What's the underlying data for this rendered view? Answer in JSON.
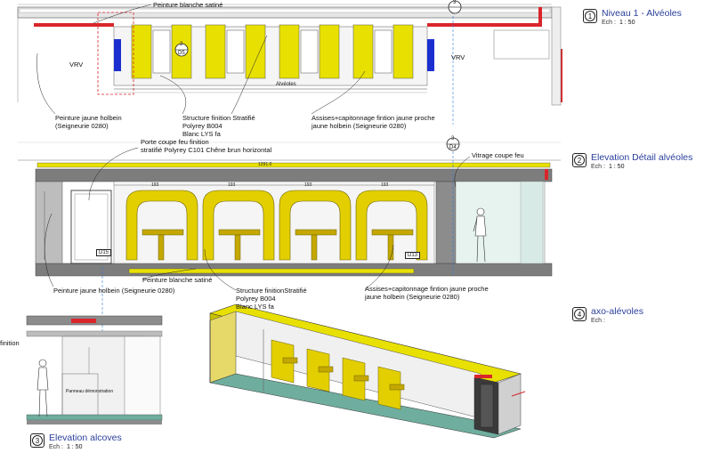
{
  "views": [
    {
      "num": "1",
      "title": "Niveau 1 - Alvéoles",
      "ech_label": "Ech :",
      "scale": "1 : 50"
    },
    {
      "num": "2",
      "title": "Elevation Détail alvéoles",
      "ech_label": "Ech :",
      "scale": "1 : 50"
    },
    {
      "num": "4",
      "title": "axo-alévoles",
      "ech_label": "Ech :",
      "scale": ""
    },
    {
      "num": "3",
      "title": "Elevation alcoves",
      "ech_label": "Ech :",
      "scale": "1 : 50"
    }
  ],
  "plan_notes": {
    "peinture_blanche": "Peinture blanche satiné",
    "vrv_left": "VRV",
    "vrv_right": "VRV",
    "alveoles": "Alvéoles",
    "peinture_jaune": "Peinture jaune holbein\n(Seigneurie 0280)",
    "structure": "Structure finition Stratifié\nPolyrey B004\nBlanc LYS fa",
    "assises": "Assises+capitonnage fintion jaune proche\njaune holbein (Seigneurie 0280)",
    "marker_top": "3",
    "marker_d5_num": "3",
    "marker_d5": "D5"
  },
  "elevation_notes": {
    "porte": "Porte coupe feu finition\nstratifié Polyrey C101 Chêne brun horizontal",
    "vitrage": "Vitrage coupe feu",
    "peinture_blanche": "Peinture blanche satiné",
    "peinture_jaune": "Peinture jaune holbein (Seigneurie 0280)",
    "structure": "Structure finitionStratifié\nPolyrey B004\nBlanc LYS fa",
    "assises": "Assises+capitonnage fintion jaune proche\njaune holbein (Seigneurie 0280)",
    "marker_num": "3",
    "marker_d4": "D4",
    "tag_d15": "D15",
    "tag_d13": "D13",
    "dim_top": "1291.0",
    "dims": [
      "193",
      "193",
      "193",
      "193"
    ]
  },
  "alcove_notes": {
    "finition": "finition",
    "panneau": "Panneau démonstration"
  }
}
